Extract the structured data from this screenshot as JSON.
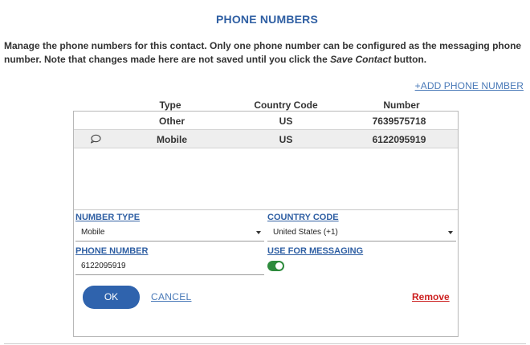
{
  "title": "PHONE NUMBERS",
  "description": {
    "part1": "Manage the phone numbers for this contact. Only one phone number can be configured as the messaging phone number. Note that changes made here are not saved until you click the ",
    "emphasis": "Save Contact",
    "part2": " button."
  },
  "add_link": "+ADD PHONE NUMBER",
  "columns": {
    "type": "Type",
    "country": "Country Code",
    "number": "Number"
  },
  "rows": [
    {
      "type": "Other",
      "country": "US",
      "number": "7639575718",
      "messaging": false,
      "selected": false
    },
    {
      "type": "Mobile",
      "country": "US",
      "number": "6122095919",
      "messaging": true,
      "selected": true,
      "icon": "speech-bubble-icon"
    }
  ],
  "form": {
    "number_type_label": "NUMBER TYPE",
    "number_type_value": "Mobile",
    "country_code_label": "COUNTRY CODE",
    "country_code_value": "United States (+1)",
    "phone_number_label": "PHONE NUMBER",
    "phone_number_value": "6122095919",
    "use_for_messaging_label": "USE FOR MESSAGING",
    "use_for_messaging": true
  },
  "buttons": {
    "ok": "OK",
    "cancel": "CANCEL",
    "remove": "Remove"
  },
  "colors": {
    "accent": "#2f5fa3",
    "button": "#2f63ad",
    "toggle_on": "#2e8b3d",
    "remove": "#cc1f1f"
  }
}
